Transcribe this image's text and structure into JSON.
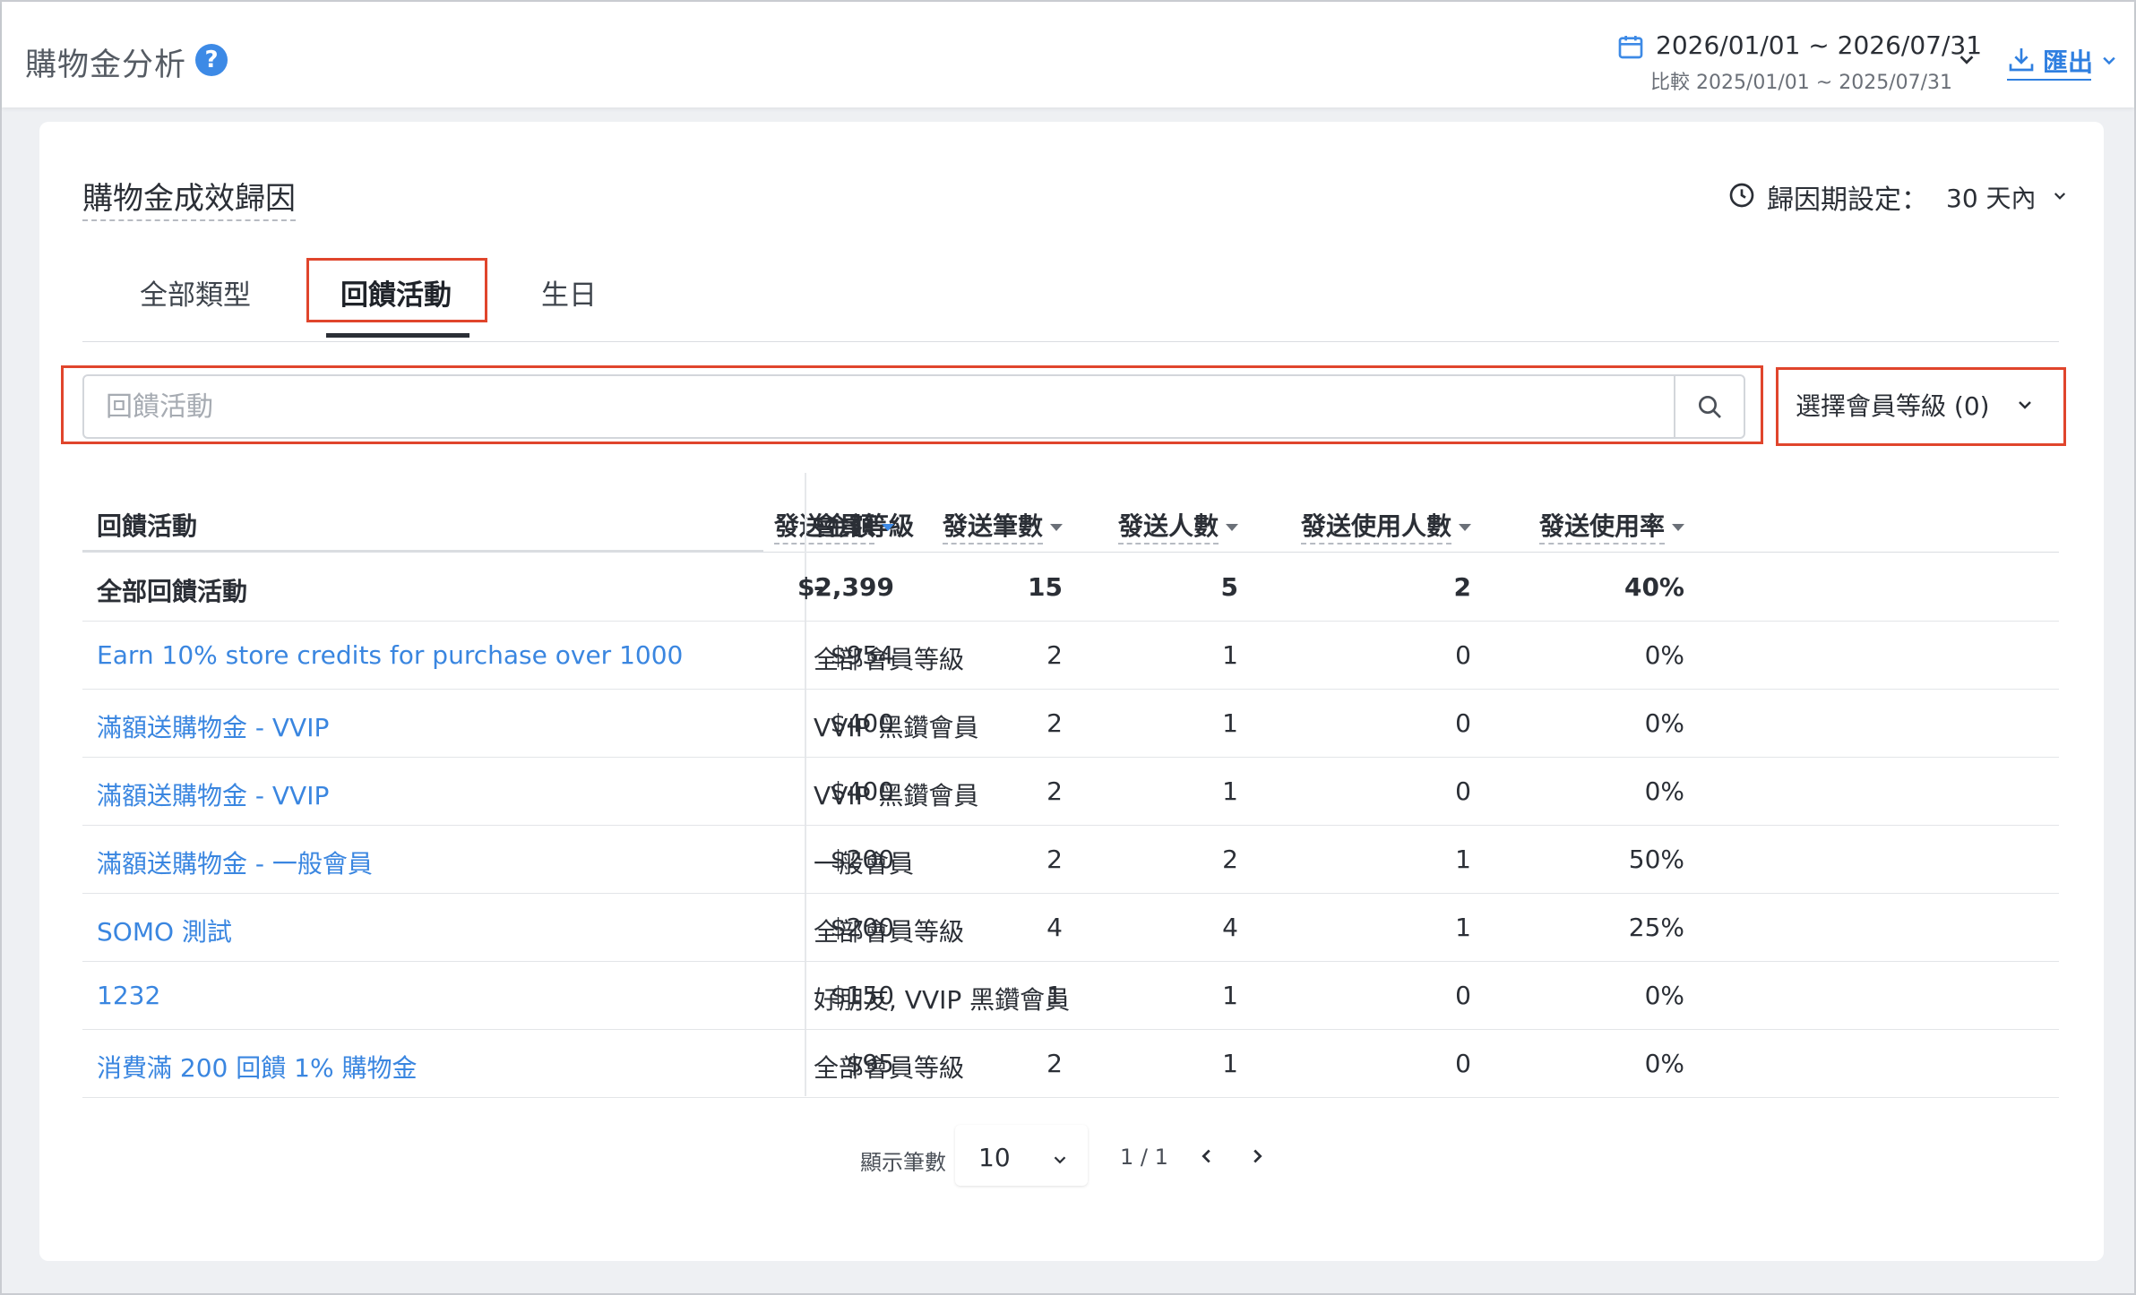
{
  "header": {
    "title": "購物金分析",
    "help_icon": "question-circle-icon",
    "date_range": "2026/01/01 ~ 2026/07/31",
    "date_compare": "比較 2025/01/01 ~ 2025/07/31",
    "export_label": "匯出"
  },
  "section": {
    "title": "購物金成效歸因",
    "attribution_label": "歸因期設定：",
    "attribution_value": "30 天內"
  },
  "tabs": [
    {
      "label": "全部類型",
      "active": false
    },
    {
      "label": "回饋活動",
      "active": true
    },
    {
      "label": "生日",
      "active": false
    }
  ],
  "search": {
    "placeholder": "回饋活動",
    "value": ""
  },
  "member_level_select": {
    "label": "選擇會員等級 (0)"
  },
  "table": {
    "headers": {
      "name": "回饋活動",
      "level": "會員等級",
      "amount": "發送金額",
      "count": "發送筆數",
      "people": "發送人數",
      "used": "發送使用人數",
      "rate": "發送使用率"
    },
    "total": {
      "name": "全部回饋活動",
      "level": "-",
      "amount": "$2,399",
      "count": "15",
      "people": "5",
      "used": "2",
      "rate": "40%"
    },
    "rows": [
      {
        "name": "Earn 10% store credits for purchase over 1000",
        "level": "全部會員等級",
        "amount": "$954",
        "count": "2",
        "people": "1",
        "used": "0",
        "rate": "0%"
      },
      {
        "name": "滿額送購物金 - VVIP",
        "level": "VVIP 黑鑽會員",
        "amount": "$400",
        "count": "2",
        "people": "1",
        "used": "0",
        "rate": "0%"
      },
      {
        "name": "滿額送購物金 - VVIP",
        "level": "VVIP 黑鑽會員",
        "amount": "$400",
        "count": "2",
        "people": "1",
        "used": "0",
        "rate": "0%"
      },
      {
        "name": "滿額送購物金 - 一般會員",
        "level": "一般會員",
        "amount": "$200",
        "count": "2",
        "people": "2",
        "used": "1",
        "rate": "50%"
      },
      {
        "name": "SOMO 測試",
        "level": "全部會員等級",
        "amount": "$200",
        "count": "4",
        "people": "4",
        "used": "1",
        "rate": "25%"
      },
      {
        "name": "1232",
        "level": "好朋友, VVIP 黑鑽會員",
        "amount": "$150",
        "count": "1",
        "people": "1",
        "used": "0",
        "rate": "0%"
      },
      {
        "name": "消費滿 200 回饋 1% 購物金",
        "level": "全部會員等級",
        "amount": "$95",
        "count": "2",
        "people": "1",
        "used": "0",
        "rate": "0%"
      }
    ]
  },
  "pagination": {
    "label": "顯示筆數",
    "page_size": "10",
    "page_info": "1 / 1"
  },
  "colors": {
    "accent": "#3d8ae6",
    "link": "#3a86e0",
    "highlight": "#e0452c"
  }
}
